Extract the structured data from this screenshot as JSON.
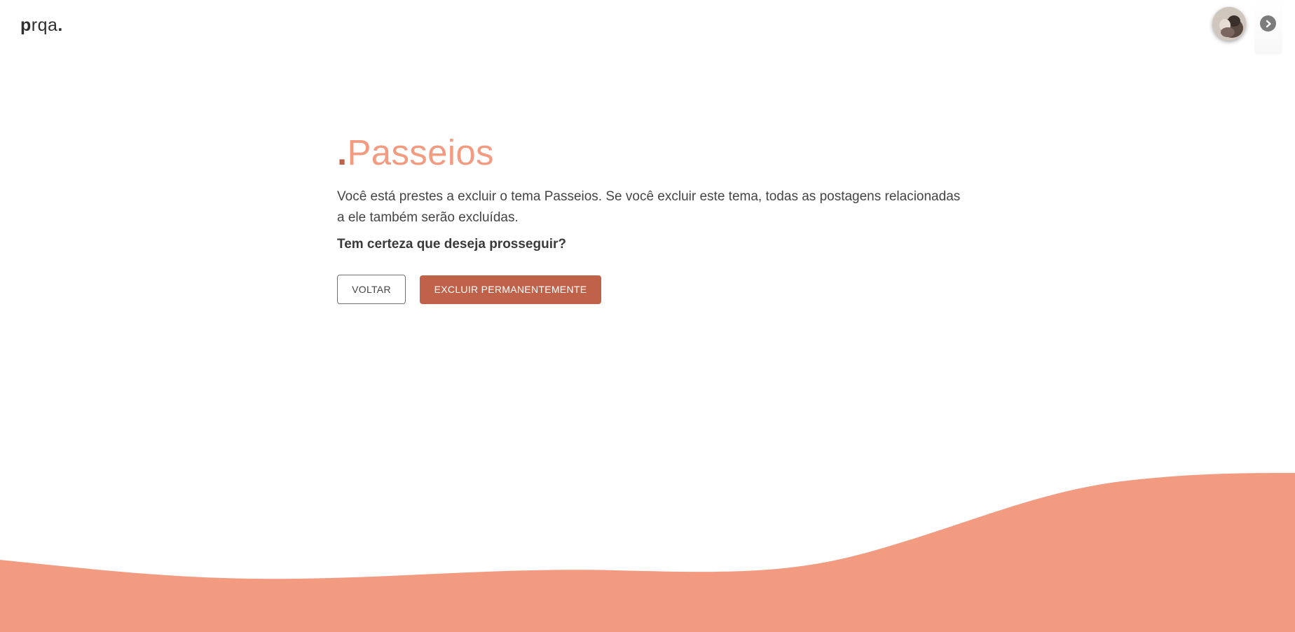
{
  "header": {
    "logo": {
      "p": "p",
      "rest": "rqa",
      "dot": "."
    },
    "avatar_icon": "user-avatar",
    "next_icon": "chevron-right-circle-icon"
  },
  "main": {
    "title_dot": ".",
    "title": "Passeios",
    "description": "Você está prestes a excluir o tema Passeios. Se você excluir este tema, todas as postagens relacionadas a ele também serão excluídas.",
    "question": "Tem certeza que deseja prosseguir?",
    "back_label": "VOLTAR",
    "delete_label": "EXCLUIR PERMANENTEMENTE"
  },
  "colors": {
    "accent": "#f29b81",
    "accent_dark": "#c0624a",
    "text": "#444444"
  }
}
